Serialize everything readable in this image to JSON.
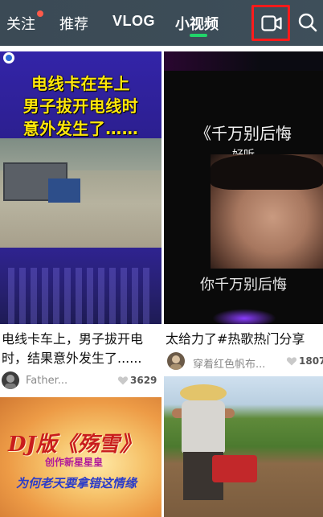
{
  "topbar": {
    "tabs": [
      "关注",
      "推荐",
      "VLOG",
      "小视频"
    ],
    "active_tab": "小视频",
    "accent_color": "#21d46a",
    "icons": [
      "camera-icon",
      "search-icon"
    ]
  },
  "cards": [
    {
      "thumb_headline": [
        "电线卡在车上",
        "男子拔开电线时",
        "意外发生了……"
      ],
      "caption": [
        "电线卡车上，男子拔开电",
        "时，结果意外发生了......"
      ],
      "author": "Father...",
      "likes": "3629"
    },
    {
      "thumb_title": "《千万别后悔",
      "thumb_subtitle": "好听",
      "thumb_lyric": "你千万别后悔",
      "caption": [
        "太给力了#热歌热门分享"
      ],
      "author": "穿着红色帆布...",
      "likes": "1807"
    },
    {
      "thumb_title": "DJ版《殇雪》",
      "thumb_subtitle": "创作新星星皇",
      "thumb_lyric": "为何老天要拿错这情缘"
    },
    {}
  ]
}
